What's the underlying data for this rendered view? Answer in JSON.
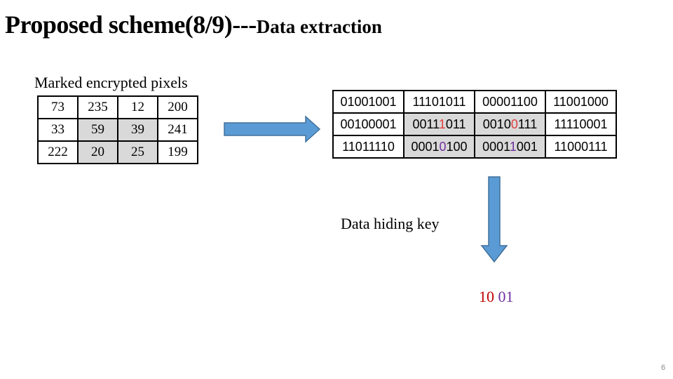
{
  "slide": {
    "title_main": "Proposed scheme(8/9)---",
    "title_sub": "Data extraction",
    "caption": "Marked encrypted pixels",
    "page_number": "6"
  },
  "pixels": {
    "rows": [
      [
        "73",
        "235",
        "12",
        "200"
      ],
      [
        "33",
        "59",
        "39",
        "241"
      ],
      [
        "222",
        "20",
        "25",
        "199"
      ]
    ]
  },
  "binary": {
    "rows": [
      [
        "01001001",
        "11101011",
        "00001100",
        "11001000"
      ],
      [
        "00100001",
        "00111011",
        "00100111",
        "11110001"
      ],
      [
        "11011110",
        "00010100",
        "00011001",
        "11000111"
      ]
    ],
    "highlighted": [
      {
        "row": 1,
        "col": 1,
        "before": "0011",
        "bit": "1",
        "after": "011",
        "color": "red"
      },
      {
        "row": 1,
        "col": 2,
        "before": "0010",
        "bit": "0",
        "after": "111",
        "color": "red"
      },
      {
        "row": 2,
        "col": 1,
        "before": "0001",
        "bit": "0",
        "after": "100",
        "color": "purple"
      },
      {
        "row": 2,
        "col": 2,
        "before": "0001",
        "bit": "1",
        "after": "001",
        "color": "purple"
      }
    ]
  },
  "key": {
    "label": "Data hiding key",
    "part1": "10",
    "part2": "01"
  },
  "colors": {
    "arrow_fill": "#5b9bd5",
    "arrow_stroke": "#41719c",
    "shade": "#d9d9d9",
    "red": "#c00000",
    "purple": "#7030a0"
  }
}
